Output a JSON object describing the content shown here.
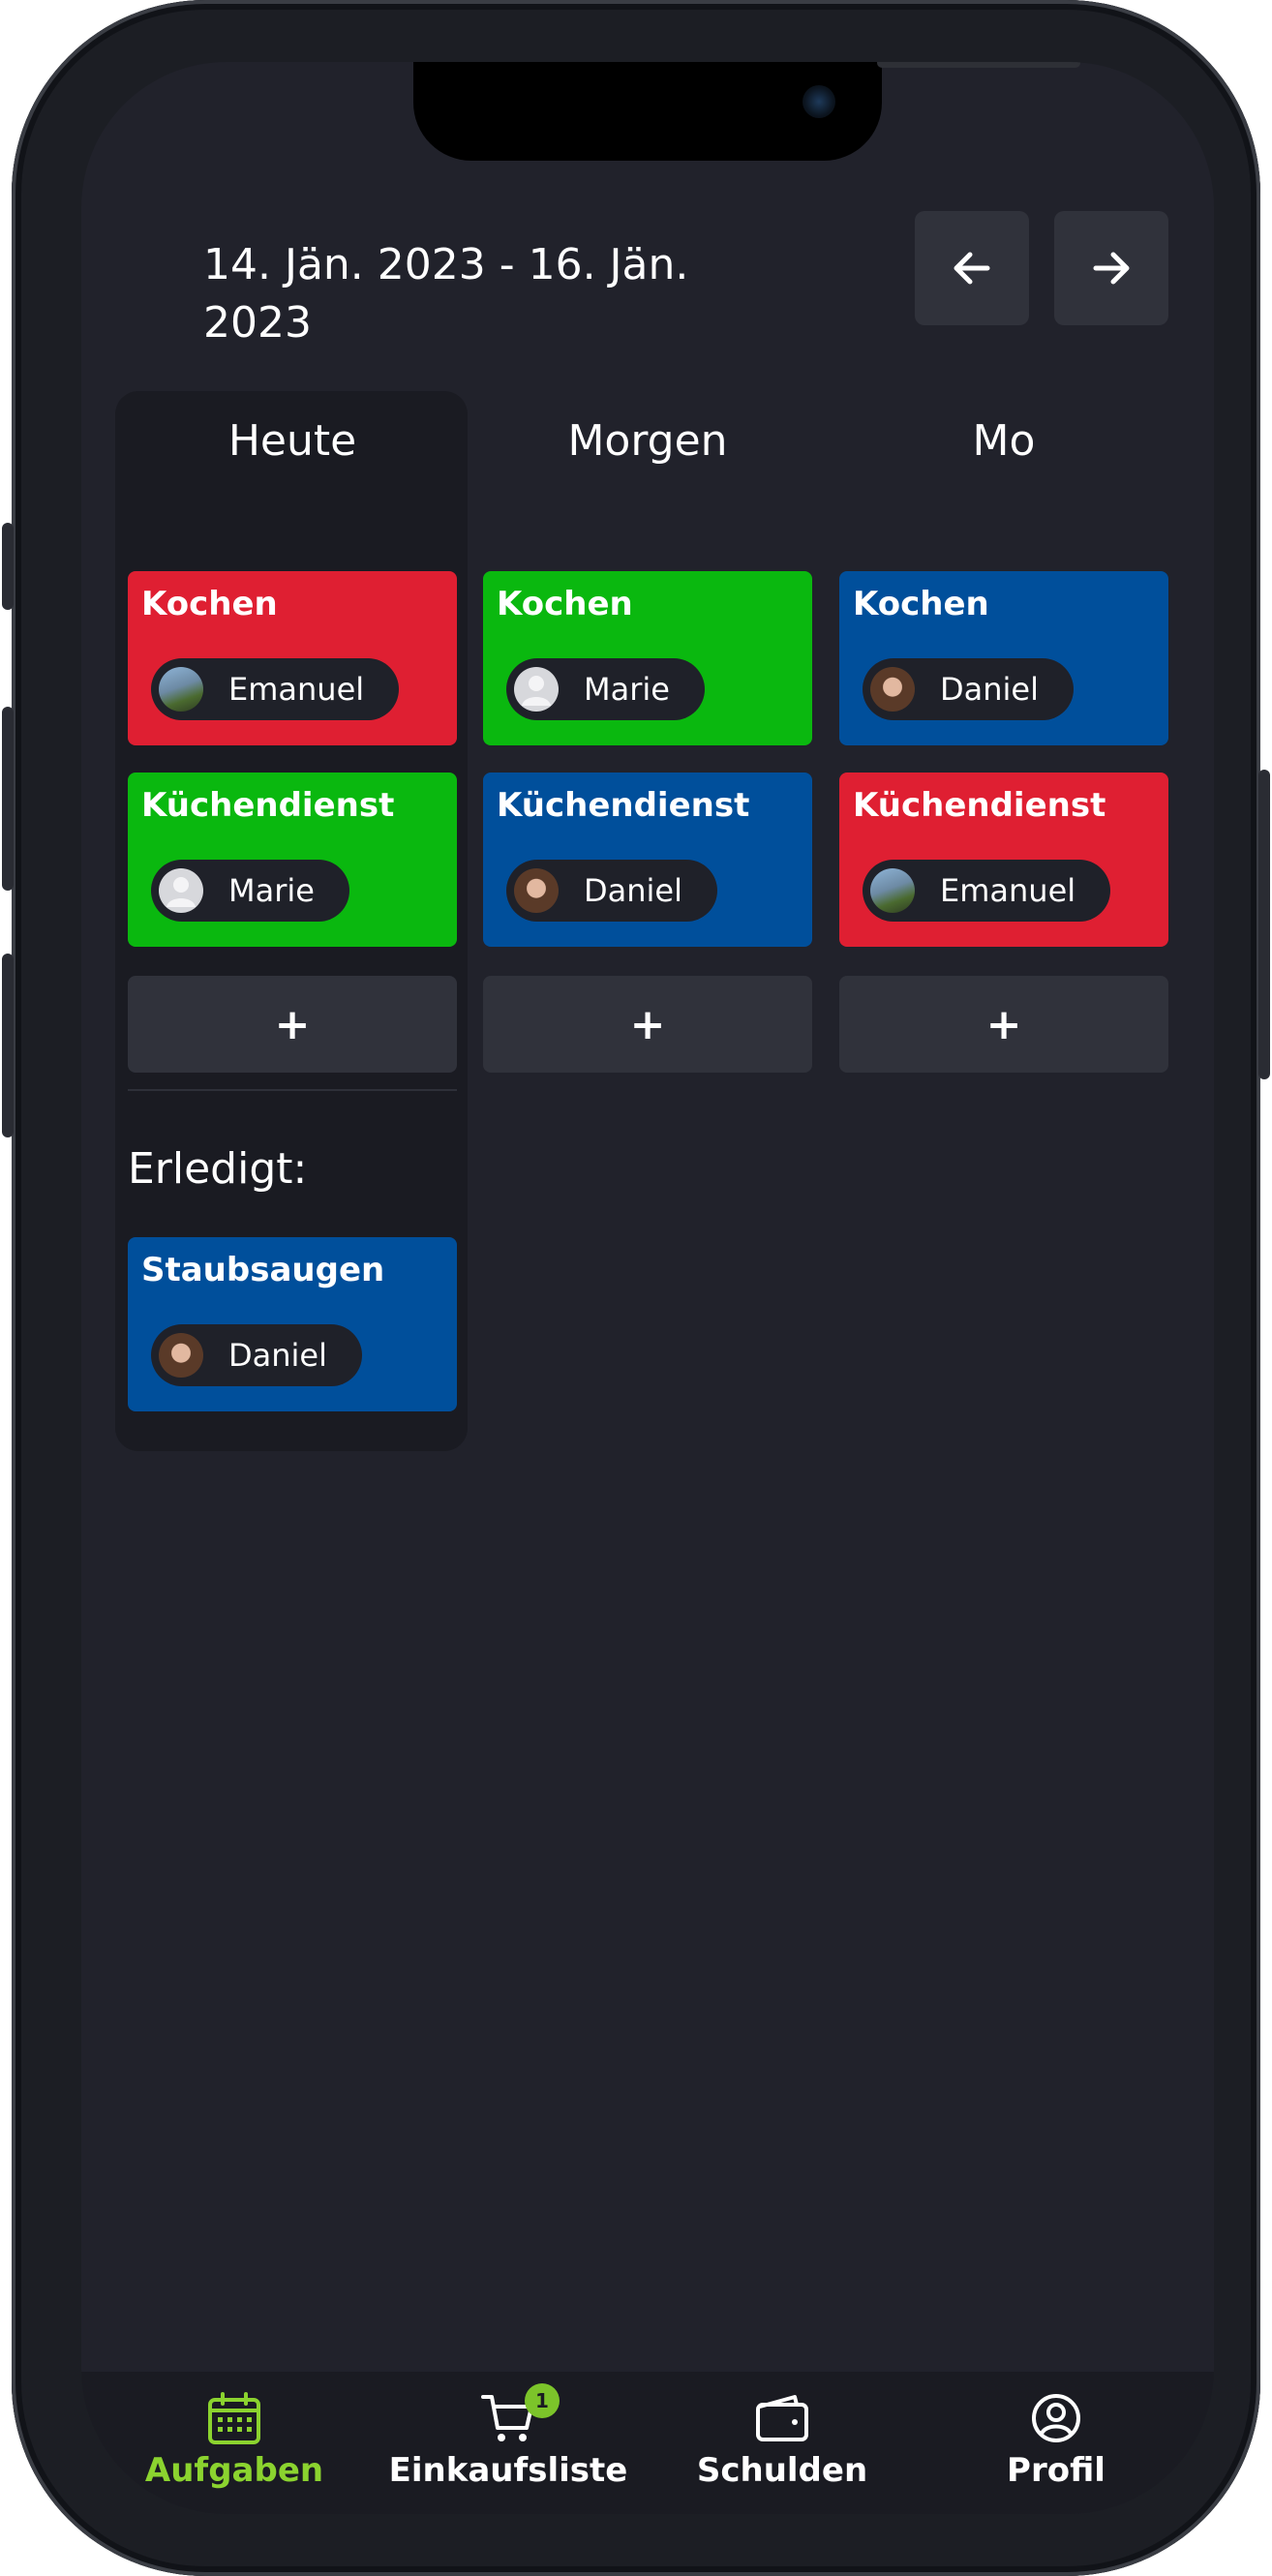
{
  "header": {
    "date_range": "14. Jän. 2023 - 16. Jän. 2023"
  },
  "colors": {
    "red": "#df1f32",
    "green": "#0ab80f",
    "blue": "#004f9b",
    "accent": "#8bd32f"
  },
  "days": [
    {
      "label": "Heute",
      "tasks": [
        {
          "title": "Kochen",
          "person": "Emanuel",
          "color": "red"
        },
        {
          "title": "Küchendienst",
          "person": "Marie",
          "color": "green"
        }
      ],
      "add_label": "+"
    },
    {
      "label": "Morgen",
      "tasks": [
        {
          "title": "Kochen",
          "person": "Marie",
          "color": "green"
        },
        {
          "title": "Küchendienst",
          "person": "Daniel",
          "color": "blue"
        }
      ],
      "add_label": "+"
    },
    {
      "label": "Mo",
      "tasks": [
        {
          "title": "Kochen",
          "person": "Daniel",
          "color": "blue"
        },
        {
          "title": "Küchendienst",
          "person": "Emanuel",
          "color": "red"
        }
      ],
      "add_label": "+"
    }
  ],
  "done": {
    "label": "Erledigt:",
    "tasks": [
      {
        "title": "Staubsaugen",
        "person": "Daniel",
        "color": "blue"
      }
    ]
  },
  "tabbar": {
    "tabs": [
      {
        "label": "Aufgaben",
        "icon": "calendar-icon",
        "active": true
      },
      {
        "label": "Einkaufsliste",
        "icon": "cart-icon",
        "badge": "1"
      },
      {
        "label": "Schulden",
        "icon": "wallet-icon"
      },
      {
        "label": "Profil",
        "icon": "profile-icon"
      }
    ]
  }
}
